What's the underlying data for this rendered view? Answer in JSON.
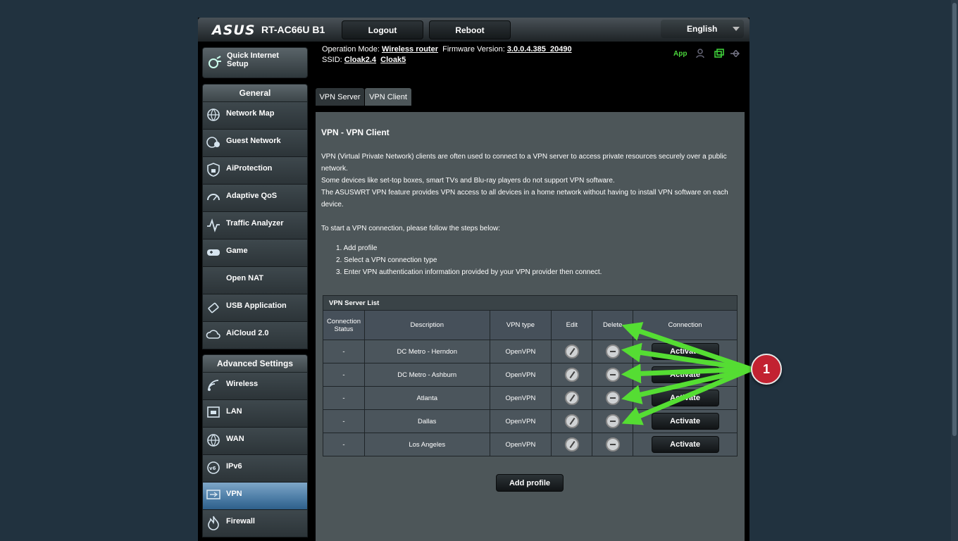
{
  "header": {
    "brand": "ASUS",
    "model": "RT-AC66U B1",
    "logout_label": "Logout",
    "reboot_label": "Reboot",
    "language": "English"
  },
  "status": {
    "op_mode_label": "Operation Mode:",
    "op_mode_value": "Wireless router",
    "firmware_label": "Firmware Version:",
    "firmware_value": "3.0.0.4.385_20490",
    "ssid_label": "SSID:",
    "ssid_1": "Cloak2.4",
    "ssid_2": "Cloak5",
    "app_label": "App"
  },
  "sidebar": {
    "quick_setup": "Quick Internet Setup",
    "general_header": "General",
    "general_items": [
      {
        "label": "Network Map",
        "icon": "globe-icon"
      },
      {
        "label": "Guest Network",
        "icon": "guest-network-icon"
      },
      {
        "label": "AiProtection",
        "icon": "shield-lock-icon"
      },
      {
        "label": "Adaptive QoS",
        "icon": "speedometer-icon"
      },
      {
        "label": "Traffic Analyzer",
        "icon": "pulse-icon"
      },
      {
        "label": "Game",
        "icon": "gamepad-icon"
      },
      {
        "label": "Open NAT",
        "icon": ""
      },
      {
        "label": "USB Application",
        "icon": "usb-icon"
      },
      {
        "label": "AiCloud 2.0",
        "icon": "cloud-icon"
      }
    ],
    "advanced_header": "Advanced Settings",
    "advanced_items": [
      {
        "label": "Wireless",
        "icon": "wireless-icon"
      },
      {
        "label": "LAN",
        "icon": "lan-icon"
      },
      {
        "label": "WAN",
        "icon": "globe-icon"
      },
      {
        "label": "IPv6",
        "icon": "ipv6-icon"
      },
      {
        "label": "VPN",
        "icon": "vpn-icon",
        "active": true
      },
      {
        "label": "Firewall",
        "icon": "fire-icon"
      }
    ]
  },
  "tabs": [
    {
      "label": "VPN Server",
      "active": false
    },
    {
      "label": "VPN Client",
      "active": true
    }
  ],
  "page": {
    "title": "VPN - VPN Client",
    "desc_1": "VPN (Virtual Private Network) clients are often used to connect to a VPN server to access private resources securely over a public network.",
    "desc_2": "Some devices like set-top boxes, smart TVs and Blu-ray players do not support VPN software.",
    "desc_3": "The ASUSWRT VPN feature provides VPN access to all devices in a home network without having to install VPN software on each device.",
    "steps_intro": "To start a VPN connection, please follow the steps below:",
    "steps": [
      "1. Add profile",
      "2. Select a VPN connection type",
      "3. Enter VPN authentication information provided by your VPN provider then connect."
    ]
  },
  "table": {
    "caption": "VPN Server List",
    "headers": [
      "Connection Status",
      "Description",
      "VPN type",
      "Edit",
      "Delete",
      "Connection"
    ],
    "rows": [
      {
        "status": "-",
        "description": "DC Metro - Herndon",
        "type": "OpenVPN",
        "action": "Activate"
      },
      {
        "status": "-",
        "description": "DC Metro - Ashburn",
        "type": "OpenVPN",
        "action": "Activate"
      },
      {
        "status": "-",
        "description": "Atlanta",
        "type": "OpenVPN",
        "action": "Activate"
      },
      {
        "status": "-",
        "description": "Dallas",
        "type": "OpenVPN",
        "action": "Activate"
      },
      {
        "status": "-",
        "description": "Los Angeles",
        "type": "OpenVPN",
        "action": "Activate"
      }
    ],
    "add_profile_label": "Add profile"
  },
  "annotation": {
    "badge_number": "1",
    "arrow_color": "#55dd33",
    "badge_color": "#c22231"
  }
}
